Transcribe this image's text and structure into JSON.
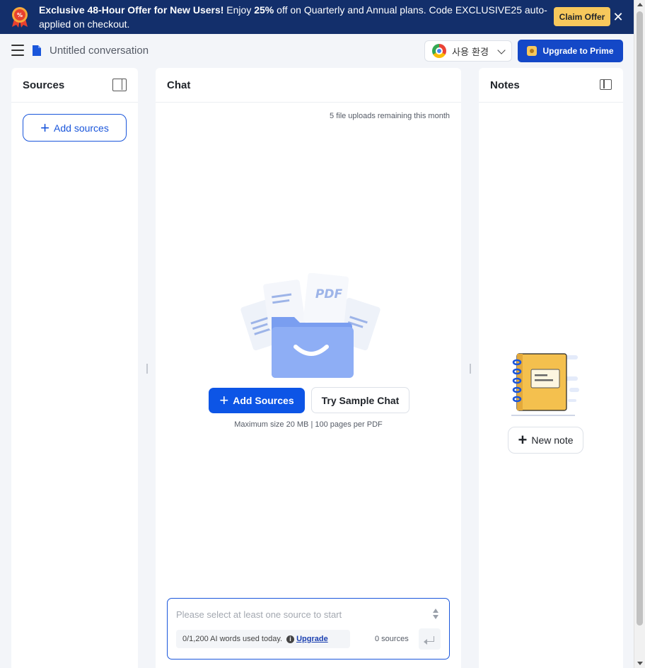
{
  "banner": {
    "headline": "Exclusive 48-Hour Offer for New Users!",
    "text_pre": " Enjoy ",
    "discount": "25%",
    "text_post": " off on Quarterly and Annual plans. Code EXCLUSIVE25 auto-applied on checkout.",
    "claim_label": "Claim Offer",
    "close_glyph": "✕"
  },
  "header": {
    "title": "Untitled conversation",
    "env_label": "사용 환경",
    "upgrade_label": "Upgrade to Prime"
  },
  "sources": {
    "title": "Sources",
    "add_label": "Add sources"
  },
  "chat": {
    "title": "Chat",
    "uploads_remaining": "5 file uploads remaining this month",
    "add_sources_label": "Add Sources",
    "try_sample_label": "Try Sample Chat",
    "max_size": "Maximum size 20 MB | 100 pages per PDF",
    "input_placeholder": "Please select at least one source to start",
    "usage_text": "0/1,200 AI words used today.",
    "upgrade_link": "Upgrade",
    "source_count": "0 sources"
  },
  "notes": {
    "title": "Notes",
    "new_note_label": "New note"
  },
  "illustration": {
    "pdf_label": "PDF"
  },
  "colors": {
    "banner_bg": "#132f6b",
    "claim_bg": "#f7c85c",
    "primary": "#0d55e6",
    "upgrade_bg": "#1448c7",
    "notebook": "#f4c04e"
  }
}
